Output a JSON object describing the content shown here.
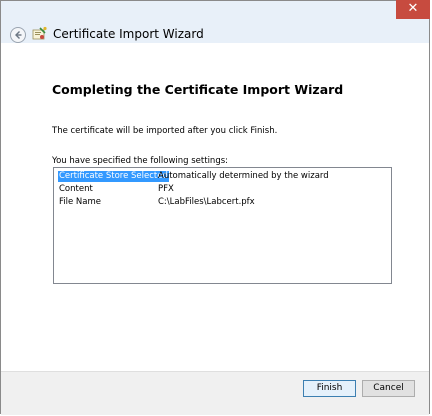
{
  "window": {
    "title": "Certificate Import Wizard",
    "close_label": "✕"
  },
  "content": {
    "heading": "Completing the Certificate Import Wizard",
    "description": "The certificate will be imported after you click Finish.",
    "settings_label": "You have specified the following settings:"
  },
  "settings": [
    {
      "key": "Certificate Store Selected",
      "value": "Automatically determined by the wizard",
      "selected": true
    },
    {
      "key": "Content",
      "value": "PFX",
      "selected": false
    },
    {
      "key": "File Name",
      "value": "C:\\LabFiles\\Labcert.pfx",
      "selected": false
    }
  ],
  "buttons": {
    "finish": "Finish",
    "cancel": "Cancel"
  },
  "colors": {
    "selection": "#3399ff",
    "close_button": "#c74b3f",
    "title_bar": "#e8f0f9"
  },
  "icons": {
    "back": "back-arrow-icon",
    "wizard": "certificate-wizard-icon",
    "close": "close-icon"
  }
}
